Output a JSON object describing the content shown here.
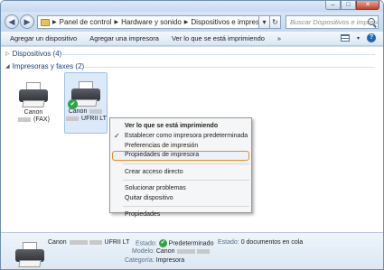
{
  "address_bar": {
    "crumbs": [
      "Panel de control",
      "Hardware y sonido",
      "Dispositivos e impresoras"
    ],
    "search_placeholder": "Buscar Dispositivos e impresoras"
  },
  "command_bar": {
    "items": [
      "Agregar un dispositivo",
      "Agregar una impresora",
      "Ver lo que se está imprimiendo",
      "»"
    ]
  },
  "groups": {
    "devices": "Dispositivos (4)",
    "printers": "Impresoras y faxes (2)"
  },
  "printers": [
    {
      "line1": "Canon",
      "line2_suffix": "(FAX)",
      "default": false
    },
    {
      "line1": "Canon",
      "line2_suffix": "UFRII LT",
      "default": true
    }
  ],
  "context_menu": {
    "items": [
      {
        "label": "Ver lo que se está imprimiendo",
        "bold": true
      },
      {
        "label": "Establecer como impresora predeterminada",
        "checked": true
      },
      {
        "label": "Preferencias de impresión"
      },
      {
        "label": "Propiedades de impresora",
        "highlighted": true
      },
      {
        "label": "Crear acceso directo"
      },
      {
        "label": "Solucionar problemas"
      },
      {
        "label": "Quitar dispositivo"
      },
      {
        "label": "Propiedades"
      }
    ]
  },
  "details": {
    "name_prefix": "Canon",
    "name_suffix": "UFRII LT",
    "estado_key": "Estado:",
    "estado_val": "Predeterminado",
    "estado2_key": "Estado:",
    "estado2_val": "0 documentos en cola",
    "modelo_key": "Modelo:",
    "modelo_val": "Canon",
    "categoria_key": "Categoría:",
    "categoria_val": "Impresora"
  },
  "colors": {
    "accent_blue": "#1e3f7a",
    "highlight_orange": "#f08a1c",
    "default_green": "#2fa443"
  }
}
